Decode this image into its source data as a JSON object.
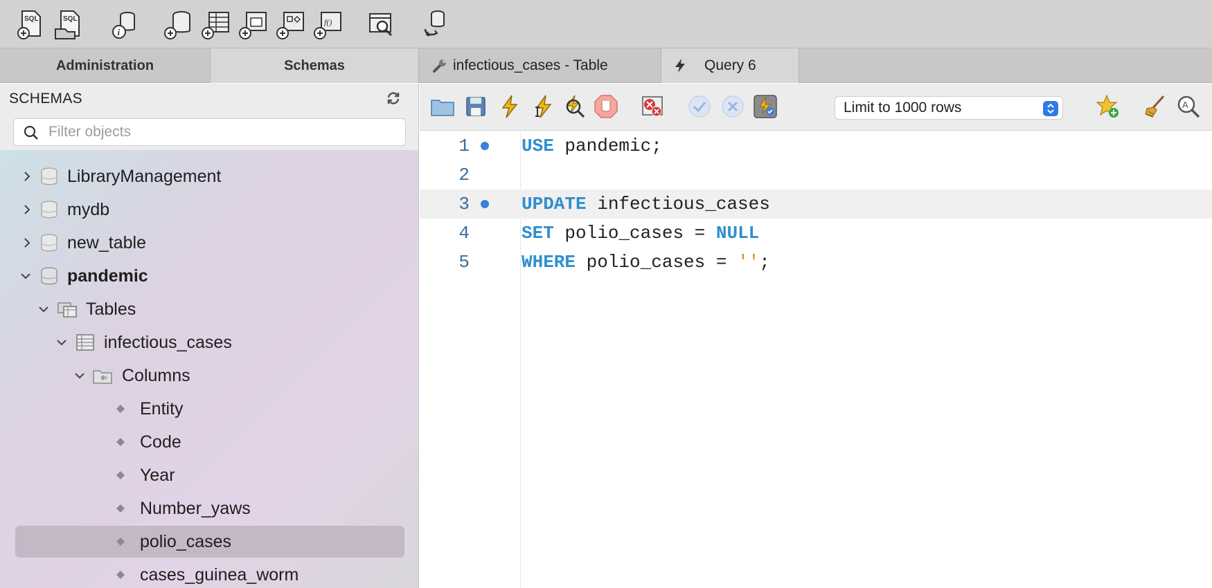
{
  "tabs": {
    "side": [
      {
        "label": "Administration"
      },
      {
        "label": "Schemas"
      }
    ],
    "documents": [
      {
        "label": "infectious_cases - Table",
        "icon": "wrench-icon"
      },
      {
        "label": "Query 6",
        "icon": "lightning-icon"
      }
    ]
  },
  "sidebar": {
    "title": "SCHEMAS",
    "filter_placeholder": "Filter objects",
    "tree": [
      {
        "label": "LibraryManagement",
        "type": "schema",
        "expanded": false
      },
      {
        "label": "mydb",
        "type": "schema",
        "expanded": false
      },
      {
        "label": "new_table",
        "type": "schema",
        "expanded": false
      },
      {
        "label": "pandemic",
        "type": "schema",
        "expanded": true
      },
      {
        "label": "Tables",
        "type": "folder",
        "expanded": true
      },
      {
        "label": "infectious_cases",
        "type": "table",
        "expanded": true
      },
      {
        "label": "Columns",
        "type": "folder",
        "expanded": true
      },
      {
        "label": "Entity",
        "type": "column"
      },
      {
        "label": "Code",
        "type": "column"
      },
      {
        "label": "Year",
        "type": "column"
      },
      {
        "label": "Number_yaws",
        "type": "column"
      },
      {
        "label": "polio_cases",
        "type": "column",
        "selected": true
      },
      {
        "label": "cases_guinea_worm",
        "type": "column"
      }
    ]
  },
  "editor": {
    "limit_label": "Limit to 1000 rows",
    "lines": [
      {
        "n": "1",
        "kw": "USE",
        "rest": " pandemic;"
      },
      {
        "n": "2",
        "kw": "",
        "rest": ""
      },
      {
        "n": "3",
        "kw": "UPDATE",
        "rest": " infectious_cases"
      },
      {
        "n": "4",
        "kw": "SET",
        "rest": " polio_cases = ",
        "kw2": "NULL"
      },
      {
        "n": "5",
        "kw": "WHERE",
        "rest": " polio_cases = ",
        "str": "''",
        "tail": ";"
      }
    ]
  },
  "colors": {
    "keyword": "#2f8fcf",
    "string": "#e08a2a",
    "line_number": "#3a6c9b",
    "statement_dot": "#3b82d6"
  }
}
